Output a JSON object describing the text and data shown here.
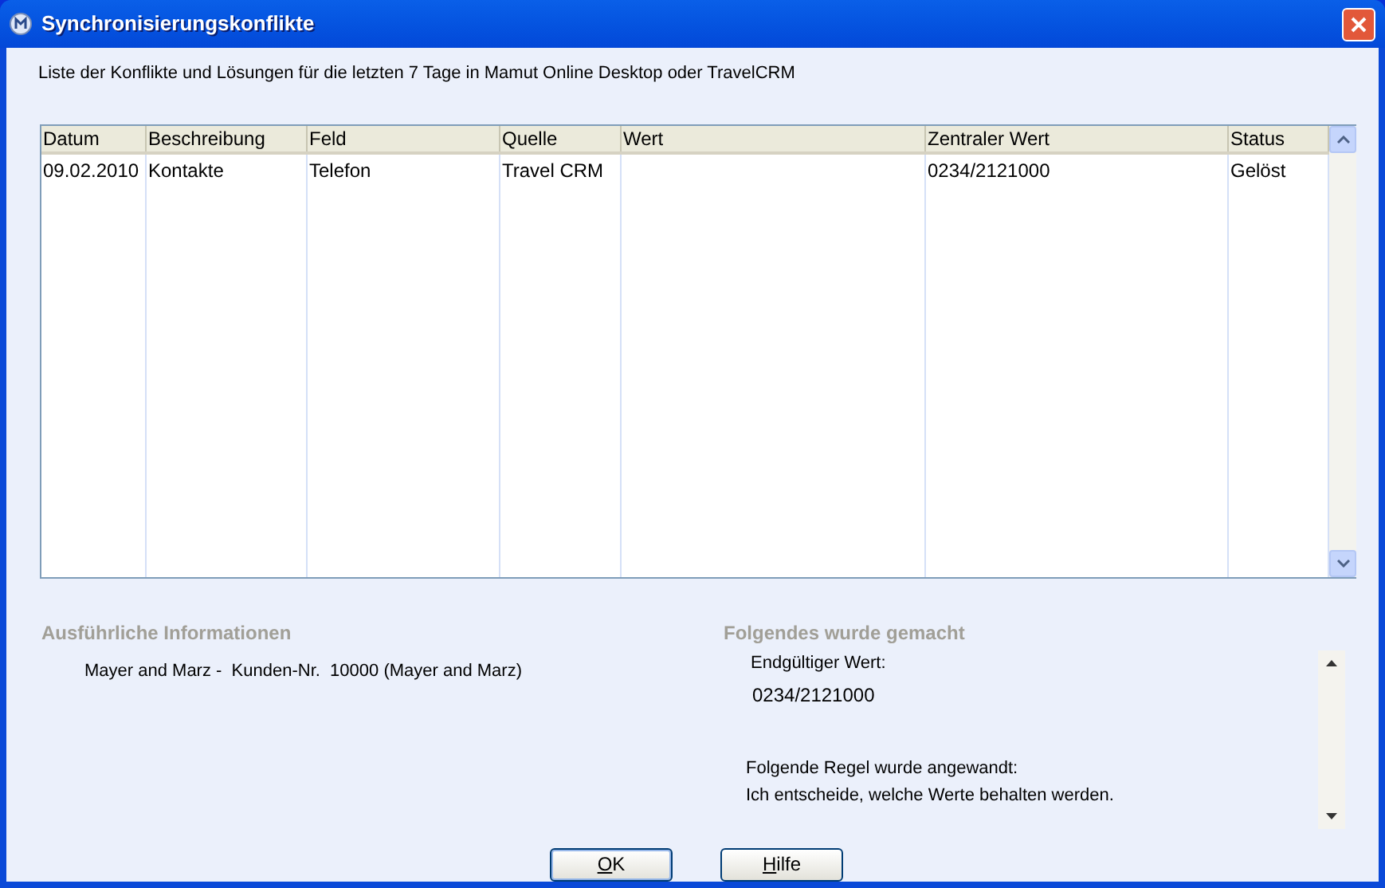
{
  "window": {
    "title": "Synchronisierungskonflikte"
  },
  "intro": "Liste der Konflikte und Lösungen für die letzten 7 Tage in Mamut Online Desktop oder TravelCRM",
  "table": {
    "columns": [
      "Datum",
      "Beschreibung",
      "Feld",
      "Quelle",
      "Wert",
      "Zentraler Wert",
      "Status"
    ],
    "rows": [
      {
        "selected": false,
        "cells": [
          "09.02.2010",
          "Kontakte",
          "Telefon",
          "Travel CRM",
          null,
          "0234/2121000",
          "Gelöst"
        ]
      }
    ]
  },
  "details": {
    "heading": "Ausführliche Informationen",
    "text": "Mayer and Marz -  Kunden-Nr.  10000 (Mayer and Marz)"
  },
  "result": {
    "heading": "Folgendes wurde gemacht",
    "final_label": "Endgültiger Wert:",
    "final_value": "0234/2121000",
    "rule_label": "Folgende Regel wurde angewandt:",
    "rule_text": "Ich entscheide, welche Werte behalten werden."
  },
  "buttons": [
    "OK",
    "Hilfe"
  ]
}
